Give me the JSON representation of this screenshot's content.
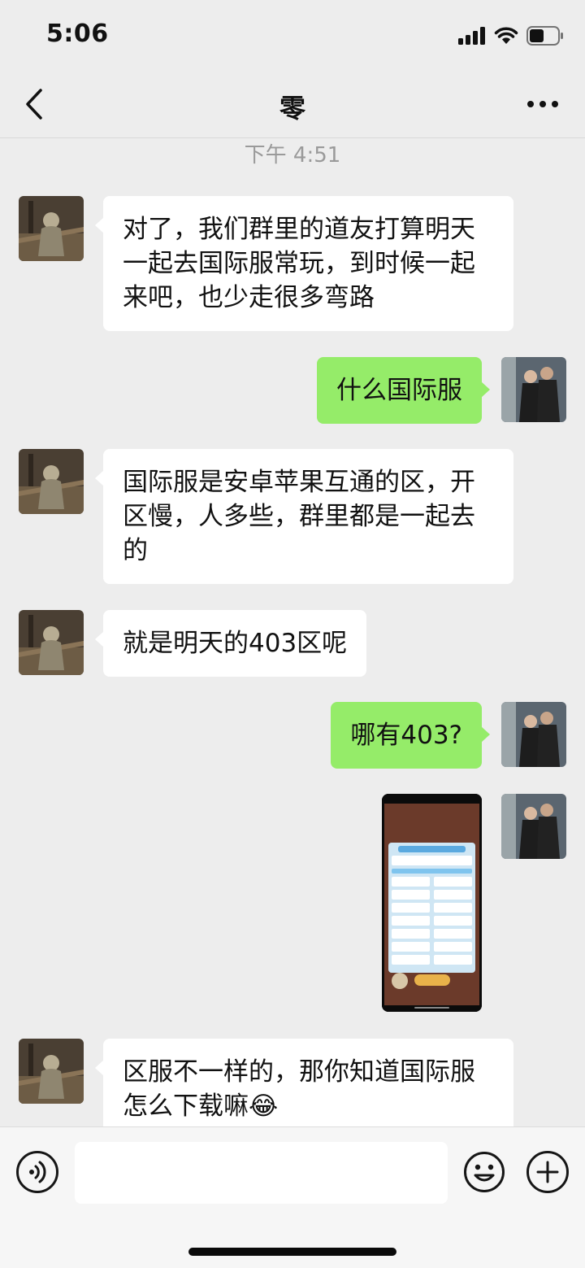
{
  "status": {
    "time": "5:06"
  },
  "nav": {
    "title": "零",
    "back_icon": "chevron-left-icon",
    "more_icon": "more-dots-icon"
  },
  "timestamp": "下午 4:51",
  "messages": [
    {
      "from": "other",
      "text": "对了，我们群里的道友打算明天一起去国际服常玩，到时候一起来吧，也少走很多弯路"
    },
    {
      "from": "me",
      "text": "什么国际服"
    },
    {
      "from": "other",
      "text": "国际服是安卓苹果互通的区，开区慢，人多些，群里都是一起去的"
    },
    {
      "from": "other",
      "text": "就是明天的403区呢"
    },
    {
      "from": "me",
      "text": "哪有403?"
    },
    {
      "from": "me",
      "type": "image"
    },
    {
      "from": "other",
      "text": "区服不一样的，那你知道国际服怎么下载嘛😂"
    }
  ],
  "input": {
    "placeholder": "",
    "value": ""
  },
  "colors": {
    "incoming_bubble": "#ffffff",
    "outgoing_bubble": "#95ec69",
    "background": "#ededed"
  }
}
